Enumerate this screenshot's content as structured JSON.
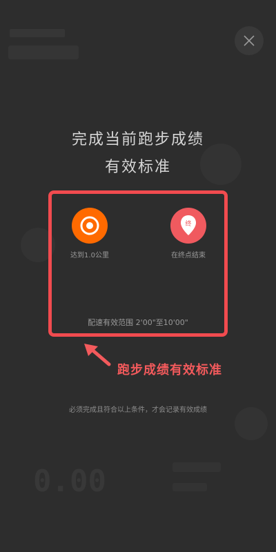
{
  "header": {
    "close_icon": "close-icon"
  },
  "headline": {
    "line1": "完成当前跑步成绩",
    "line2": "有效标准"
  },
  "criteria": [
    {
      "icon": "target-icon",
      "color": "#ff6a00",
      "label": "达到1.0公里"
    },
    {
      "icon": "finish-pin-icon",
      "color": "#f05a5f",
      "pin_text": "终",
      "label": "在终点结束"
    }
  ],
  "pace": {
    "text": "配速有效范围 2'00\"至10'00\""
  },
  "annotation": {
    "text": "跑步成绩有效标准",
    "color": "#f35a5c"
  },
  "footnote": {
    "text": "必须完成且符合以上条件，才会记录有效成绩"
  },
  "background": {
    "distance_value": "0.00"
  },
  "colors": {
    "highlight_border": "#f14b4f",
    "overlay_bg": "#2d2d2d"
  }
}
